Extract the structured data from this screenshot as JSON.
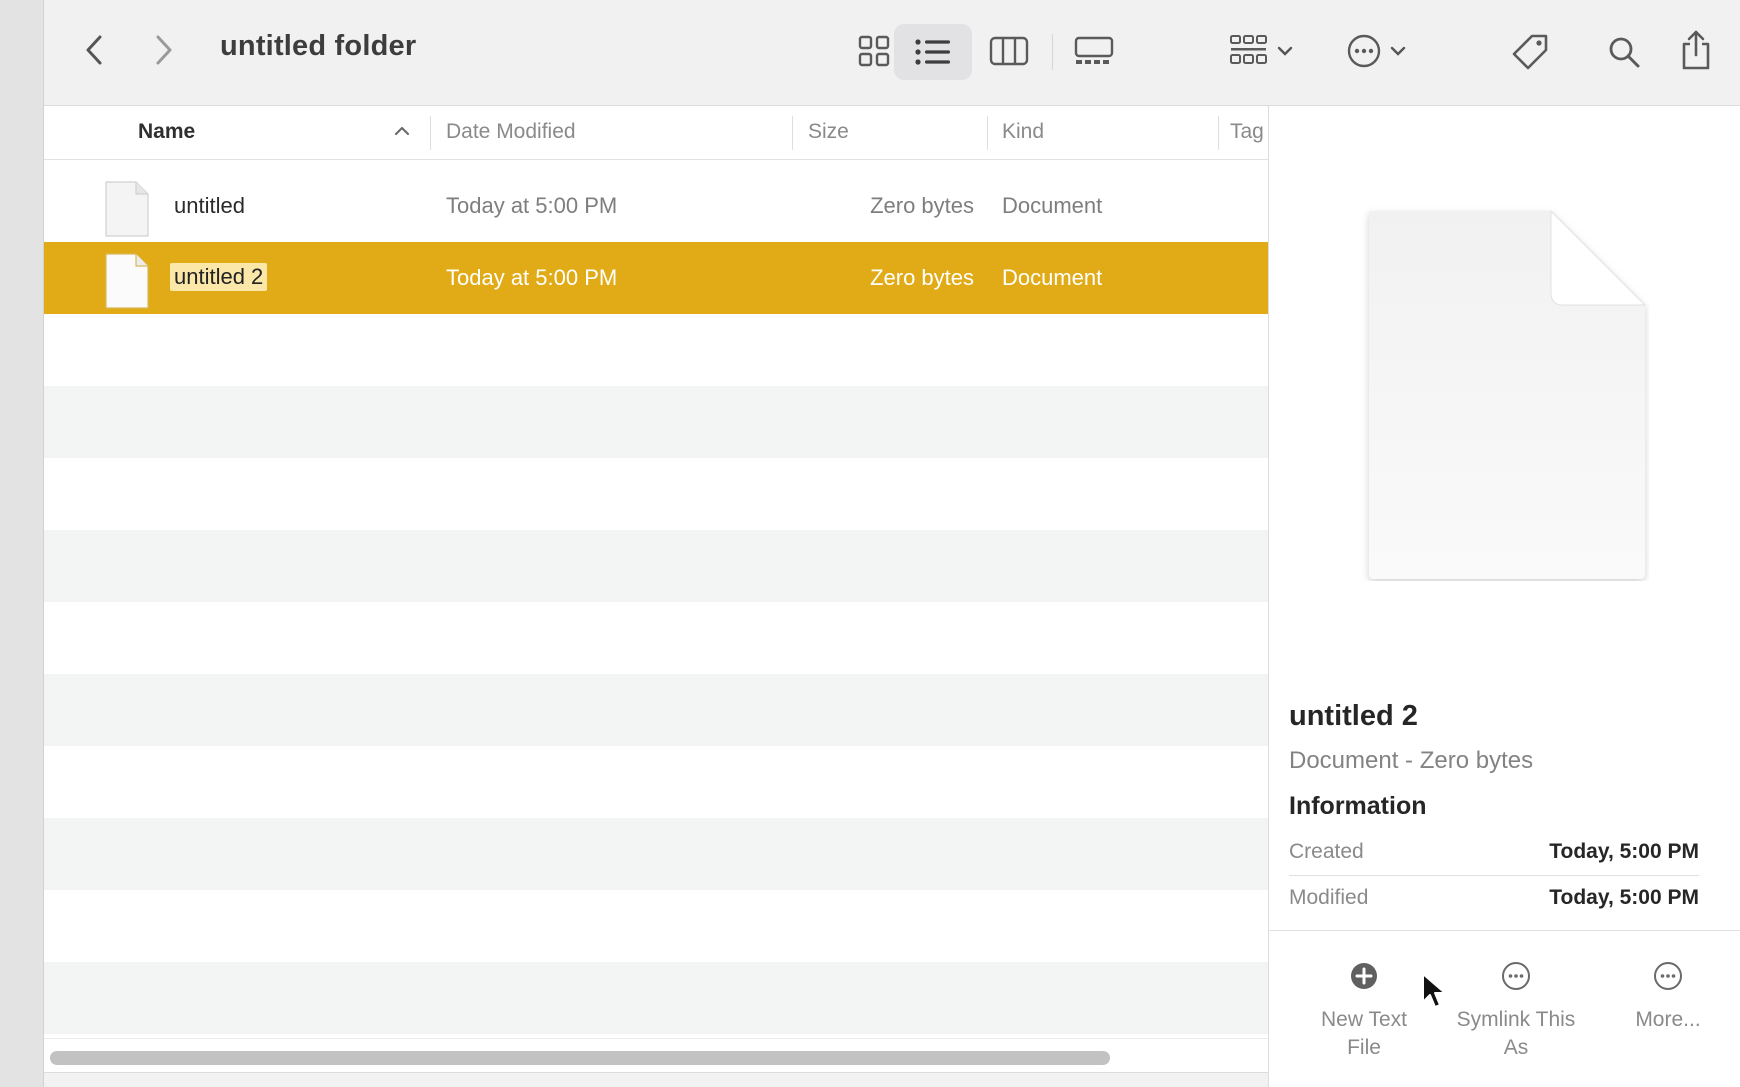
{
  "window": {
    "title": "untitled folder"
  },
  "toolbar": {
    "icons": [
      "chevron-left-icon",
      "chevron-right-icon",
      "icon-view-icon",
      "list-view-icon",
      "column-view-icon",
      "gallery-view-icon",
      "group-icon",
      "more-actions-icon",
      "tag-icon",
      "search-icon",
      "share-icon"
    ],
    "active_view": "list"
  },
  "columns": {
    "name": "Name",
    "date_modified": "Date Modified",
    "size": "Size",
    "kind": "Kind",
    "tags": "Tag"
  },
  "files": [
    {
      "name": "untitled",
      "date_modified": "Today at 5:00 PM",
      "size": "Zero bytes",
      "kind": "Document",
      "selected": false
    },
    {
      "name": "untitled 2",
      "date_modified": "Today at 5:00 PM",
      "size": "Zero bytes",
      "kind": "Document",
      "selected": true
    }
  ],
  "preview": {
    "title": "untitled 2",
    "subtitle": "Document - Zero bytes",
    "info_heading": "Information",
    "created_label": "Created",
    "created_value": "Today, 5:00 PM",
    "modified_label": "Modified",
    "modified_value": "Today, 5:00 PM",
    "actions": [
      {
        "label": "New Text File",
        "icon": "plus-circle-icon"
      },
      {
        "label": "Symlink This As",
        "icon": "ellipsis-circle-icon"
      },
      {
        "label": "More...",
        "icon": "ellipsis-circle-icon"
      }
    ]
  },
  "colors": {
    "selection": "#e0ab16",
    "stripe": "#f3f4f4",
    "toolbar_bg": "#f2f1f2"
  }
}
